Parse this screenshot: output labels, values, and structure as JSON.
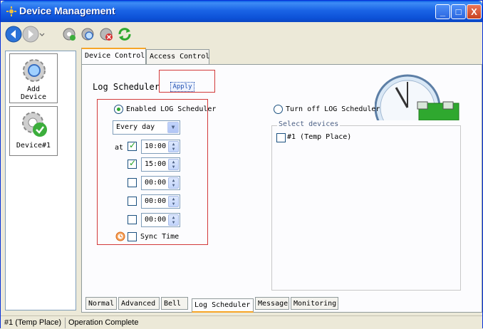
{
  "window": {
    "title": "Device Management",
    "controls": {
      "minimize": "_",
      "maximize": "□",
      "close": "X"
    }
  },
  "toolbar": {
    "icons": [
      "back-icon",
      "forward-icon",
      "settings-icon",
      "search-devices-icon",
      "remove-device-icon",
      "refresh-icon"
    ]
  },
  "sidebar": {
    "items": [
      {
        "label_line1": "Add",
        "label_line2": "Device",
        "icon": "add-device-icon"
      },
      {
        "label": "Device#1",
        "icon": "device-ok-icon"
      }
    ]
  },
  "tabs_top": [
    "Device Control",
    "Access Control"
  ],
  "log_scheduler": {
    "title": "Log Scheduler",
    "apply": "Apply",
    "enabled_label": "Enabled LOG Scheduler",
    "enabled": true,
    "turn_off_label": "Turn off LOG Scheduler",
    "frequency": "Every day",
    "at_label": "at",
    "times": [
      {
        "checked": true,
        "value": "10:00"
      },
      {
        "checked": true,
        "value": "15:00"
      },
      {
        "checked": false,
        "value": "00:00"
      },
      {
        "checked": false,
        "value": "00:00"
      },
      {
        "checked": false,
        "value": "00:00"
      }
    ],
    "sync_time_label": "Sync Time",
    "sync_time_checked": false
  },
  "select_devices": {
    "legend": "Select devices",
    "devices": [
      {
        "label": "#1 (Temp Place)",
        "checked": false
      }
    ]
  },
  "tabs_bottom": [
    "Normal",
    "Advanced",
    "Bell",
    "Log Scheduler",
    "Message",
    "Monitoring"
  ],
  "active_bottom_tab": "Log Scheduler",
  "status": {
    "device": "#1 (Temp Place)",
    "message": "Operation Complete"
  },
  "colors": {
    "titlebar": "#0a52d8",
    "highlight_box": "#d23a3a",
    "tab_active_accent": "#f7a628"
  }
}
